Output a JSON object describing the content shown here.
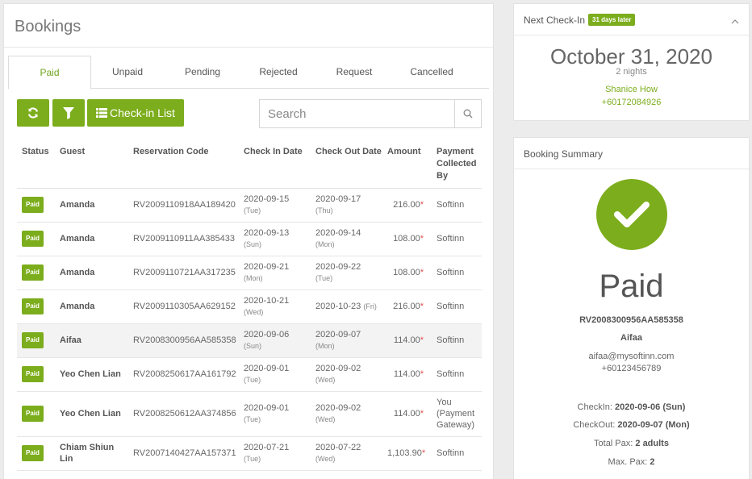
{
  "bookings": {
    "title": "Bookings",
    "tabs": [
      "Paid",
      "Unpaid",
      "Pending",
      "Rejected",
      "Request",
      "Cancelled"
    ],
    "active_tab": "Paid",
    "toolbar": {
      "checkin_list_label": "Check-in List",
      "search_placeholder": "Search"
    },
    "columns": [
      "Status",
      "Guest",
      "Reservation Code",
      "Check In Date",
      "Check Out Date",
      "Amount",
      "Payment Collected By"
    ],
    "rows": [
      {
        "status": "Paid",
        "guest": "Amanda",
        "code": "RV2009110918AA189420",
        "checkin": "2020-09-15",
        "checkin_day": "(Tue)",
        "checkout": "2020-09-17",
        "checkout_day": "(Thu)",
        "amount": "216.00",
        "collected_by": "Softinn"
      },
      {
        "status": "Paid",
        "guest": "Amanda",
        "code": "RV2009110911AA385433",
        "checkin": "2020-09-13",
        "checkin_day": "(Sun)",
        "checkout": "2020-09-14",
        "checkout_day": "(Mon)",
        "amount": "108.00",
        "collected_by": "Softinn"
      },
      {
        "status": "Paid",
        "guest": "Amanda",
        "code": "RV2009110721AA317235",
        "checkin": "2020-09-21",
        "checkin_day": "(Mon)",
        "checkout": "2020-09-22",
        "checkout_day": "(Tue)",
        "amount": "108.00",
        "collected_by": "Softinn"
      },
      {
        "status": "Paid",
        "guest": "Amanda",
        "code": "RV2009110305AA629152",
        "checkin": "2020-10-21",
        "checkin_day": "(Wed)",
        "checkout": "2020-10-23",
        "checkout_day": "(Fri)",
        "amount": "216.00",
        "collected_by": "Softinn"
      },
      {
        "status": "Paid",
        "guest": "Aifaa",
        "code": "RV2008300956AA585358",
        "checkin": "2020-09-06",
        "checkin_day": "(Sun)",
        "checkout": "2020-09-07",
        "checkout_day": "(Mon)",
        "amount": "114.00",
        "collected_by": "Softinn"
      },
      {
        "status": "Paid",
        "guest": "Yeo Chen Lian",
        "code": "RV2008250617AA161792",
        "checkin": "2020-09-01",
        "checkin_day": "(Tue)",
        "checkout": "2020-09-02",
        "checkout_day": "(Wed)",
        "amount": "114.00",
        "collected_by": "Softinn"
      },
      {
        "status": "Paid",
        "guest": "Yeo Chen Lian",
        "code": "RV2008250612AA374856",
        "checkin": "2020-09-01",
        "checkin_day": "(Tue)",
        "checkout": "2020-09-02",
        "checkout_day": "(Wed)",
        "amount": "114.00",
        "collected_by": "You (Payment Gateway)"
      },
      {
        "status": "Paid",
        "guest": "Chiam Shiun Lin",
        "code": "RV2007140427AA157371",
        "checkin": "2020-07-21",
        "checkin_day": "(Tue)",
        "checkout": "2020-07-22",
        "checkout_day": "(Wed)",
        "amount": "1,103.90",
        "collected_by": "Softinn"
      }
    ],
    "amount_marker": "*"
  },
  "next_checkin": {
    "title": "Next Check-In",
    "badge": "31 days later",
    "date": "October 31, 2020",
    "nights": "2 nights",
    "guest_name": "Shanice How",
    "guest_phone": "+60172084926"
  },
  "summary": {
    "title": "Booking Summary",
    "status": "Paid",
    "code": "RV2008300956AA585358",
    "guest": "Aifaa",
    "email": "aifaa@mysoftinn.com",
    "phone": "+60123456789",
    "checkin_label": "CheckIn:",
    "checkin_value": "2020-09-06 (Sun)",
    "checkout_label": "CheckOut:",
    "checkout_value": "2020-09-07 (Mon)",
    "pax_label": "Total Pax:",
    "pax_value": "2 adults",
    "max_pax_label": "Max. Pax:",
    "max_pax_value": "2"
  },
  "colors": {
    "accent": "#7cad1c",
    "accent_text": "#6ea31b",
    "amount_marker": "#e05050"
  },
  "icons": [
    "refresh-icon",
    "filter-icon",
    "list-icon",
    "search-icon",
    "chevron-up-icon",
    "checkmark-icon"
  ]
}
